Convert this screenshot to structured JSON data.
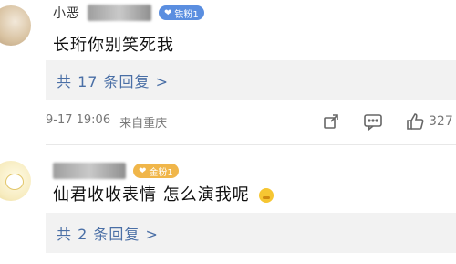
{
  "comment1": {
    "username": "小恶",
    "fan_badge": "铁粉1",
    "text": "长珩你别笑死我",
    "replies_link": "共 17 条回复 >",
    "time": "9-17 19:06",
    "location": "来自重庆",
    "like_count": "327"
  },
  "comment2": {
    "fan_badge": "金粉1",
    "text": "仙君收收表情 怎么演我呢",
    "replies_link": "共 2 条回复 >"
  },
  "icons": [
    "share-icon",
    "comment-icon",
    "like-icon",
    "emoji-icon"
  ],
  "colors": {
    "link": "#4a6fa6",
    "reply_bg": "#f2f2f2",
    "badge_blue": "#5a8ee0",
    "badge_gold": "#f0b64a"
  }
}
